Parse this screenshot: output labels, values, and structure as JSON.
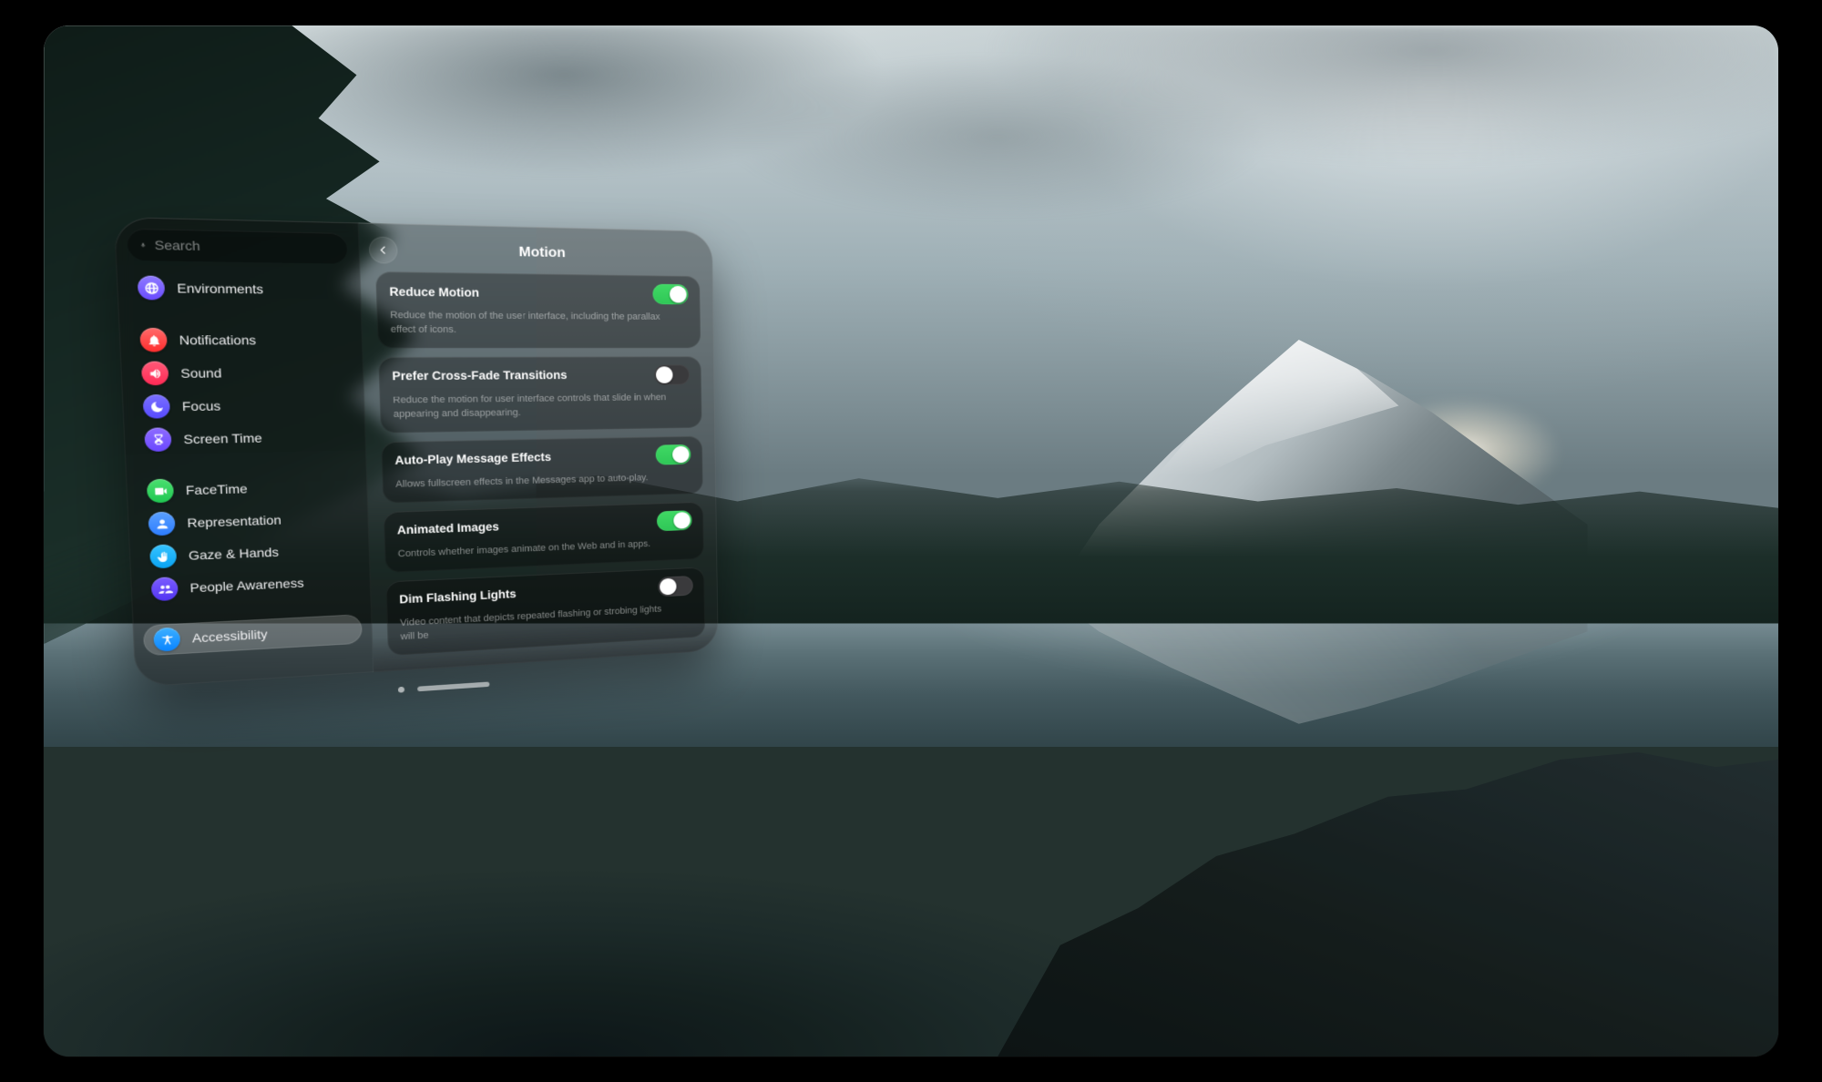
{
  "search": {
    "placeholder": "Search"
  },
  "sidebar": {
    "items": [
      {
        "id": "environments",
        "label": "Environments",
        "icon": "globe-icon",
        "color": "bg-purple"
      },
      {
        "id": "notifications",
        "label": "Notifications",
        "icon": "bell-icon",
        "color": "bg-red"
      },
      {
        "id": "sound",
        "label": "Sound",
        "icon": "speaker-icon",
        "color": "bg-redpink"
      },
      {
        "id": "focus",
        "label": "Focus",
        "icon": "moon-icon",
        "color": "bg-indigo"
      },
      {
        "id": "screen-time",
        "label": "Screen Time",
        "icon": "hourglass-icon",
        "color": "bg-violet"
      },
      {
        "id": "facetime",
        "label": "FaceTime",
        "icon": "video-icon",
        "color": "bg-green"
      },
      {
        "id": "representation",
        "label": "Representation",
        "icon": "person-icon",
        "color": "bg-blue"
      },
      {
        "id": "gaze-hands",
        "label": "Gaze & Hands",
        "icon": "hand-icon",
        "color": "bg-cyan"
      },
      {
        "id": "people-awareness",
        "label": "People Awareness",
        "icon": "people-icon",
        "color": "bg-deep"
      },
      {
        "id": "accessibility",
        "label": "Accessibility",
        "icon": "accessibility-icon",
        "color": "bg-access",
        "selected": true
      }
    ]
  },
  "detail": {
    "title": "Motion",
    "settings": [
      {
        "id": "reduce-motion",
        "title": "Reduce Motion",
        "on": true,
        "desc": "Reduce the motion of the user interface, including the parallax effect of icons."
      },
      {
        "id": "prefer-cross-fade",
        "title": "Prefer Cross-Fade Transitions",
        "on": false,
        "desc": "Reduce the motion for user interface controls that slide in when appearing and disappearing."
      },
      {
        "id": "auto-play-effects",
        "title": "Auto-Play Message Effects",
        "on": true,
        "desc": "Allows fullscreen effects in the Messages app to auto-play."
      },
      {
        "id": "animated-images",
        "title": "Animated Images",
        "on": true,
        "desc": "Controls whether images animate on the Web and in apps."
      },
      {
        "id": "dim-flashing-lights",
        "title": "Dim Flashing Lights",
        "on": false,
        "desc": "Video content that depicts repeated flashing or strobing lights will be"
      }
    ]
  },
  "colors": {
    "toggle_on": "#33d15b",
    "toggle_off": "#3a3a3c",
    "accent": "#0a84ff"
  }
}
